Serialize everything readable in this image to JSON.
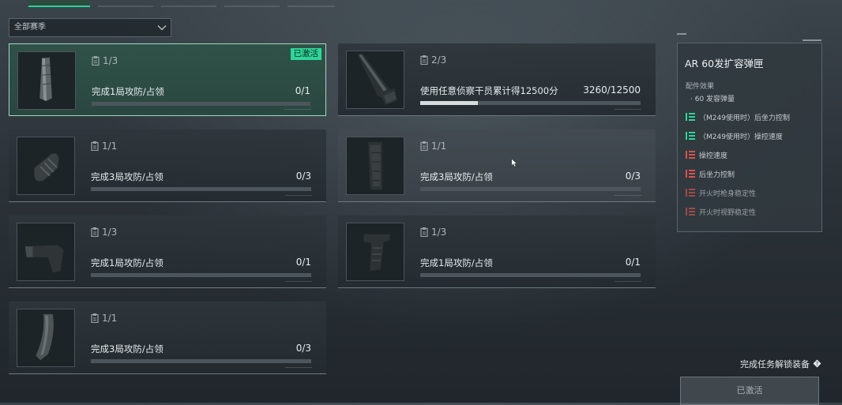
{
  "season_select": {
    "label": "全部赛季"
  },
  "tasks": [
    {
      "count": "1/3",
      "task": "完成1局攻防/占领",
      "progress": "0/1",
      "progress_ratio": 0.0,
      "badge": "已激活",
      "item_icon": "extended-magazine-icon",
      "state": "activated"
    },
    {
      "count": "2/3",
      "task": "使用任意侦察干员累计得12500分",
      "progress": "3260/12500",
      "progress_ratio": 0.26,
      "item_icon": "stock-icon",
      "state": "normal"
    },
    {
      "count": "1/1",
      "task": "完成3局攻防/占领",
      "progress": "0/3",
      "progress_ratio": 0.0,
      "item_icon": "grip-cover-icon",
      "state": "normal"
    },
    {
      "count": "1/1",
      "task": "完成3局攻防/占领",
      "progress": "0/3",
      "progress_ratio": 0.0,
      "item_icon": "magazine-icon",
      "state": "hover"
    },
    {
      "count": "1/3",
      "task": "完成1局攻防/占领",
      "progress": "0/1",
      "progress_ratio": 0.0,
      "item_icon": "butt-stock-icon",
      "state": "normal"
    },
    {
      "count": "1/3",
      "task": "完成1局攻防/占领",
      "progress": "0/1",
      "progress_ratio": 0.0,
      "item_icon": "pistol-grip-icon",
      "state": "normal"
    },
    {
      "count": "1/1",
      "task": "完成3局攻防/占领",
      "progress": "0/3",
      "progress_ratio": 0.0,
      "item_icon": "curved-magazine-icon",
      "state": "normal"
    }
  ],
  "detail": {
    "title": "AR 60发扩容弹匣",
    "subhead": "配件效果",
    "stats": [
      {
        "text": "· 60 发容弹量",
        "type": "info"
      },
      {
        "text": "（M249使用时）后坐力控制",
        "type": "up"
      },
      {
        "text": "（M249使用时）操控速度",
        "type": "up"
      },
      {
        "text": "操控速度",
        "type": "down"
      },
      {
        "text": "后坐力控制",
        "type": "down"
      },
      {
        "text": "开火时枪身稳定性",
        "type": "down-dim"
      },
      {
        "text": "开火时视野稳定性",
        "type": "down-dim"
      }
    ]
  },
  "footer": {
    "unlock_hint": "完成任务解锁装备",
    "activate_button": "已激活"
  },
  "colors": {
    "accent": "#2fd59b",
    "up": "#2fd59b",
    "down": "#d9534f"
  }
}
